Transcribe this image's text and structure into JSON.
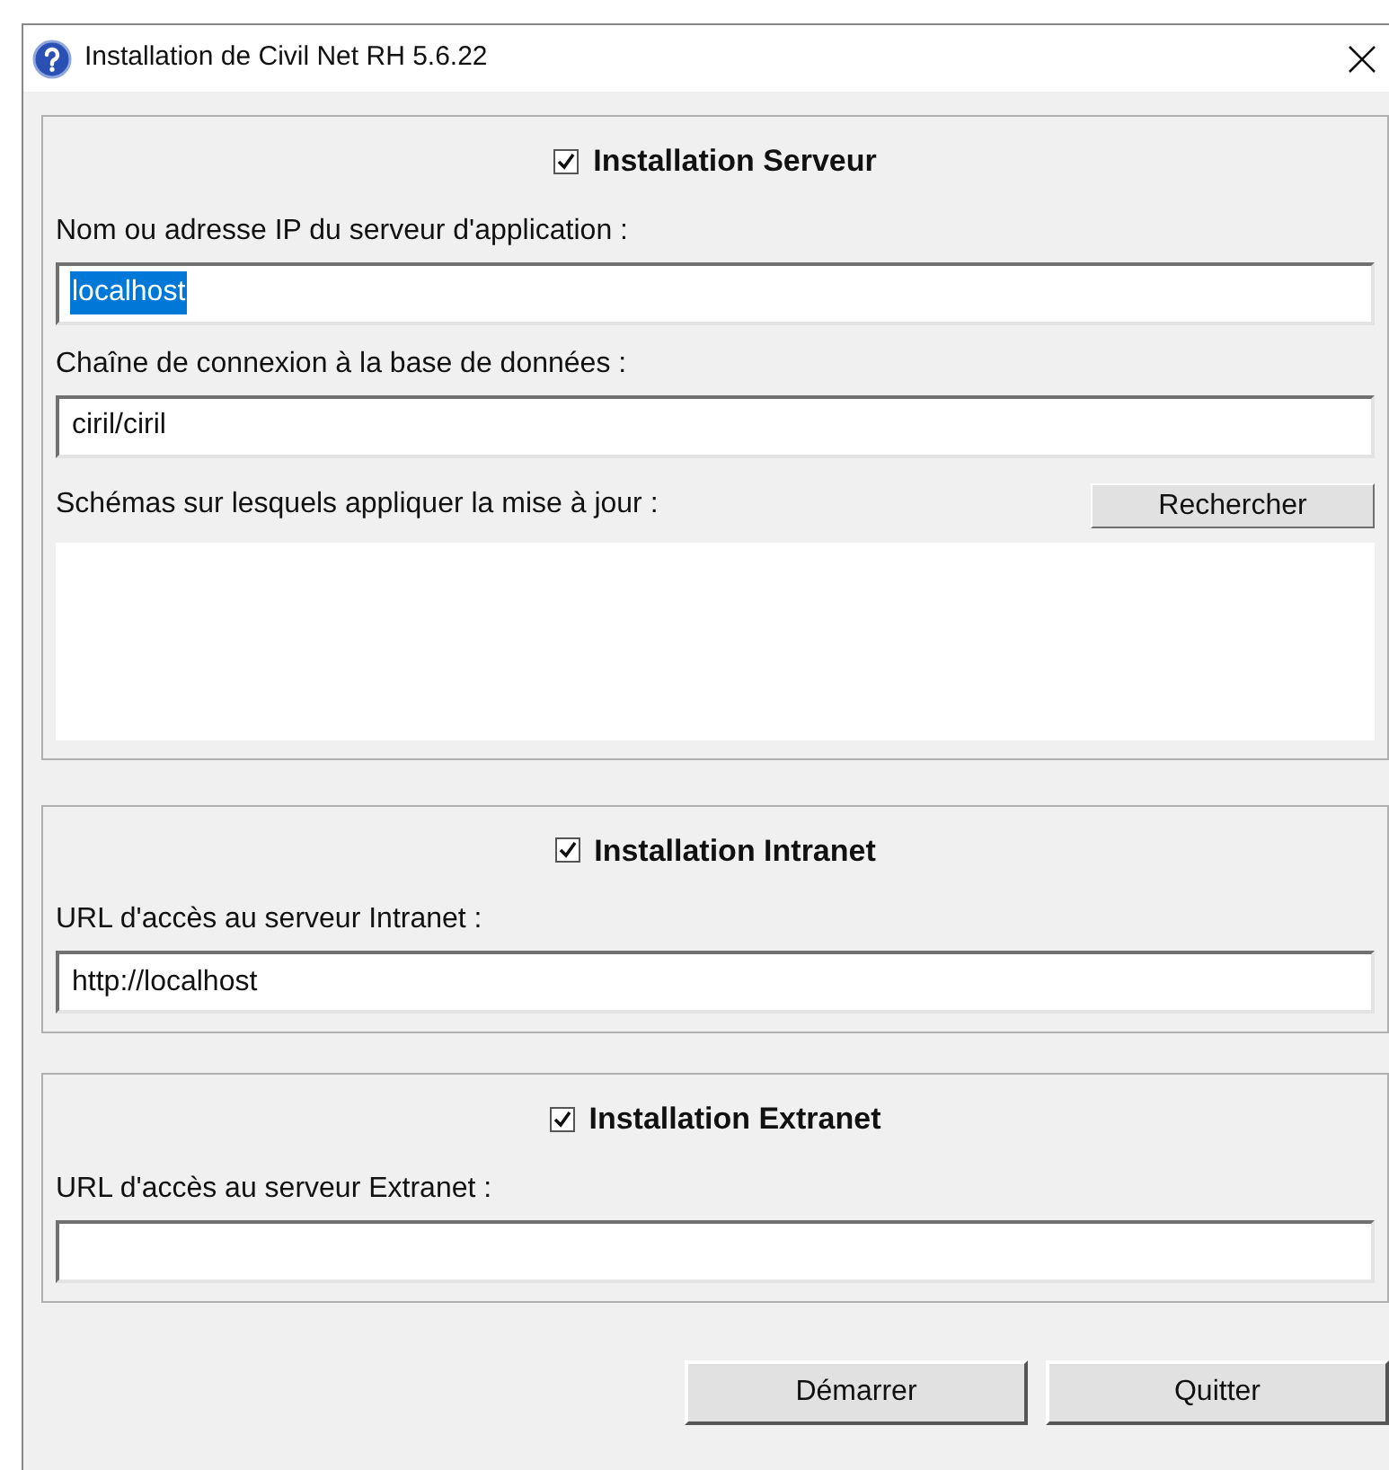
{
  "window": {
    "title": "Installation de Civil Net RH 5.6.22"
  },
  "sections": [
    {
      "title": "Installation Serveur",
      "checked": true,
      "items": [
        {
          "kind": "label",
          "text": "Nom ou adresse IP du serveur d'application :"
        },
        {
          "kind": "field",
          "value": "localhost",
          "text_selected": true
        },
        {
          "kind": "label",
          "text": "Chaîne de connexion à la base de données :"
        },
        {
          "kind": "field",
          "value": "ciril/ciril"
        },
        {
          "kind": "label_button",
          "text": "Schémas sur lesquels appliquer la mise à jour :",
          "button": "Rechercher"
        },
        {
          "kind": "list"
        }
      ]
    },
    {
      "title": "Installation Intranet",
      "checked": true,
      "items": [
        {
          "kind": "label",
          "text": "URL d'accès au serveur Intranet :"
        },
        {
          "kind": "field",
          "value": "http://localhost"
        }
      ]
    },
    {
      "title": "Installation Extranet",
      "checked": true,
      "items": [
        {
          "kind": "label",
          "text": "URL d'accès au serveur Extranet :"
        },
        {
          "kind": "field"
        }
      ]
    }
  ],
  "buttons": [
    "Démarrer",
    "Quitter"
  ]
}
